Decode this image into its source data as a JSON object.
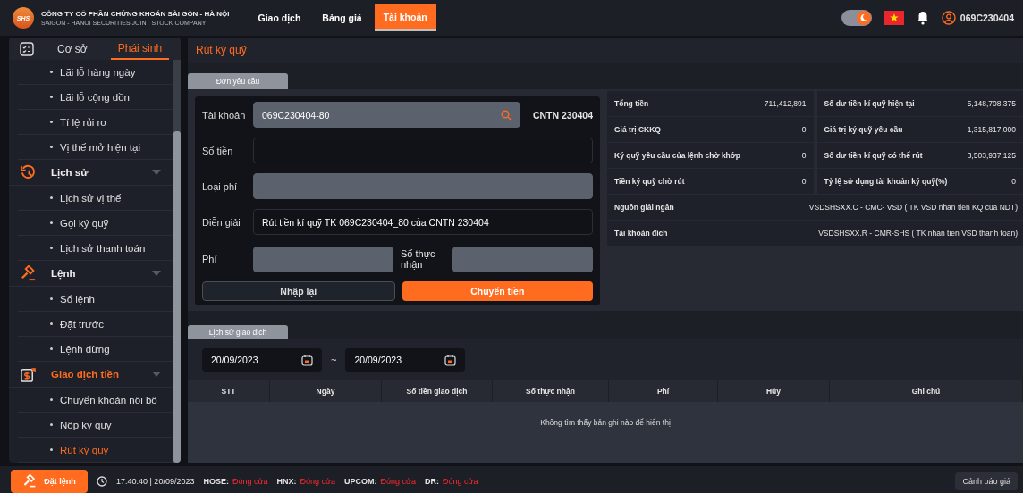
{
  "header": {
    "logo_text": "SHS",
    "company_name": "CÔNG TY CỔ PHẦN CHỨNG KHOÁN SÀI GÒN - HÀ NỘI",
    "company_name_en": "SAIGON - HANOI SECURITIES JOINT STOCK COMPANY",
    "nav": [
      {
        "label": "Giao dịch",
        "selected": false
      },
      {
        "label": "Bảng giá",
        "selected": false
      },
      {
        "label": "Tài khoản",
        "selected": true
      }
    ],
    "dark_mode": true,
    "user": "069C230404"
  },
  "sidebar": {
    "tabs": [
      {
        "label": "Cơ sở",
        "selected": false
      },
      {
        "label": "Phái sinh",
        "selected": true
      }
    ],
    "menu": [
      {
        "kind": "item",
        "label": "Lãi lỗ hàng ngày",
        "selected": false
      },
      {
        "kind": "item",
        "label": "Lãi lỗ cộng dồn",
        "selected": false
      },
      {
        "kind": "item",
        "label": "Tí lệ rủi ro",
        "selected": false
      },
      {
        "kind": "item",
        "label": "Vị thế mở hiện tại",
        "selected": false
      },
      {
        "kind": "group",
        "label": "Lịch sử",
        "selected": false,
        "expanded": true,
        "children": [
          {
            "label": "Lịch sử vị thế",
            "selected": false
          },
          {
            "label": "Gọi ký quỹ",
            "selected": false
          },
          {
            "label": "Lịch sử thanh toán",
            "selected": false
          }
        ]
      },
      {
        "kind": "group",
        "label": "Lệnh",
        "selected": false,
        "expanded": true,
        "children": [
          {
            "label": "Sổ lệnh",
            "selected": false
          },
          {
            "label": "Đặt trước",
            "selected": false
          },
          {
            "label": "Lệnh dừng",
            "selected": false
          }
        ]
      },
      {
        "kind": "group",
        "label": "Giao dịch tiền",
        "selected": true,
        "expanded": true,
        "children": [
          {
            "label": "Chuyển khoản nội bộ",
            "selected": false
          },
          {
            "label": "Nộp ký quỹ",
            "selected": false
          },
          {
            "label": "Rút ký quỹ",
            "selected": true
          }
        ]
      }
    ]
  },
  "page_title": "Rút ký quỹ",
  "request": {
    "tab": "Đơn yêu cầu",
    "fields": [
      {
        "kind": "lookup",
        "label": "Tài khoản",
        "value": "069C230404-80",
        "disabled": true,
        "suffix": "CNTN 230404"
      },
      {
        "kind": "text",
        "label": "Số tiền",
        "disabled": false
      },
      {
        "kind": "text",
        "label": "Loại phí",
        "disabled": true
      },
      {
        "kind": "text",
        "label": "Diễn giải",
        "value": "Rút tiền kí quỹ TK 069C230404_80 của CNTN 230404",
        "disabled": false
      },
      {
        "kind": "pair",
        "label": "Phí",
        "disabled": true,
        "label2": "Số thực nhận",
        "disabled2": true
      }
    ],
    "buttons": [
      {
        "label": "Nhập lại",
        "kind": "secondary"
      },
      {
        "label": "Chuyển tiền",
        "kind": "primary"
      }
    ]
  },
  "summary": [
    {
      "label": "Tổng tiền",
      "value": "711,412,891"
    },
    {
      "label": "Số dư tiền kí quỹ hiện tại",
      "value": "5,148,708,375"
    },
    {
      "label": "Giá trị CKKQ",
      "value": "0"
    },
    {
      "label": "Giá trị ký quỹ yêu cầu",
      "value": "1,315,817,000"
    },
    {
      "label": "Ký quỹ yêu cầu của lệnh chờ khớp",
      "value": "0"
    },
    {
      "label": "Số dư tiền kí quỹ có thể rút",
      "value": "3,503,937,125"
    },
    {
      "label": "Tiền ký quỹ chờ rút",
      "value": "0"
    },
    {
      "label": "Tỷ lệ sử dụng tài khoản ký quỹ(%)",
      "value": "0"
    }
  ],
  "accounts": [
    {
      "label": "Nguồn giải ngân",
      "value": "VSDSHSXX.C - CMC- VSD ( TK VSD nhan tien KQ cua NDT)"
    },
    {
      "label": "Tài khoản đích",
      "value": "VSDSHSXX.R - CMR-SHS ( TK nhan tien VSD thanh toan)"
    }
  ],
  "history": {
    "tab": "Lịch sử giao dịch",
    "from_date": "20/09/2023",
    "separator": "~",
    "to_date": "20/09/2023",
    "table": {
      "columns": [
        "STT",
        "Ngày",
        "Số tiền giao dịch",
        "Số thực nhận",
        "Phí",
        "Hủy",
        "Ghi chú"
      ],
      "empty_message": "Không tìm thấy bản ghi nào để hiển thị"
    }
  },
  "status_bar": {
    "order_button": "Đặt lệnh",
    "time": "17:40:40 | 20/09/2023",
    "markets": [
      {
        "name": "HOSE:",
        "status": "Đóng cửa"
      },
      {
        "name": "HNX:",
        "status": "Đóng cửa"
      },
      {
        "name": "UPCOM:",
        "status": "Đóng cửa"
      },
      {
        "name": "DR:",
        "status": "Đóng cửa"
      }
    ],
    "alert_button": "Cảnh báo giá"
  }
}
